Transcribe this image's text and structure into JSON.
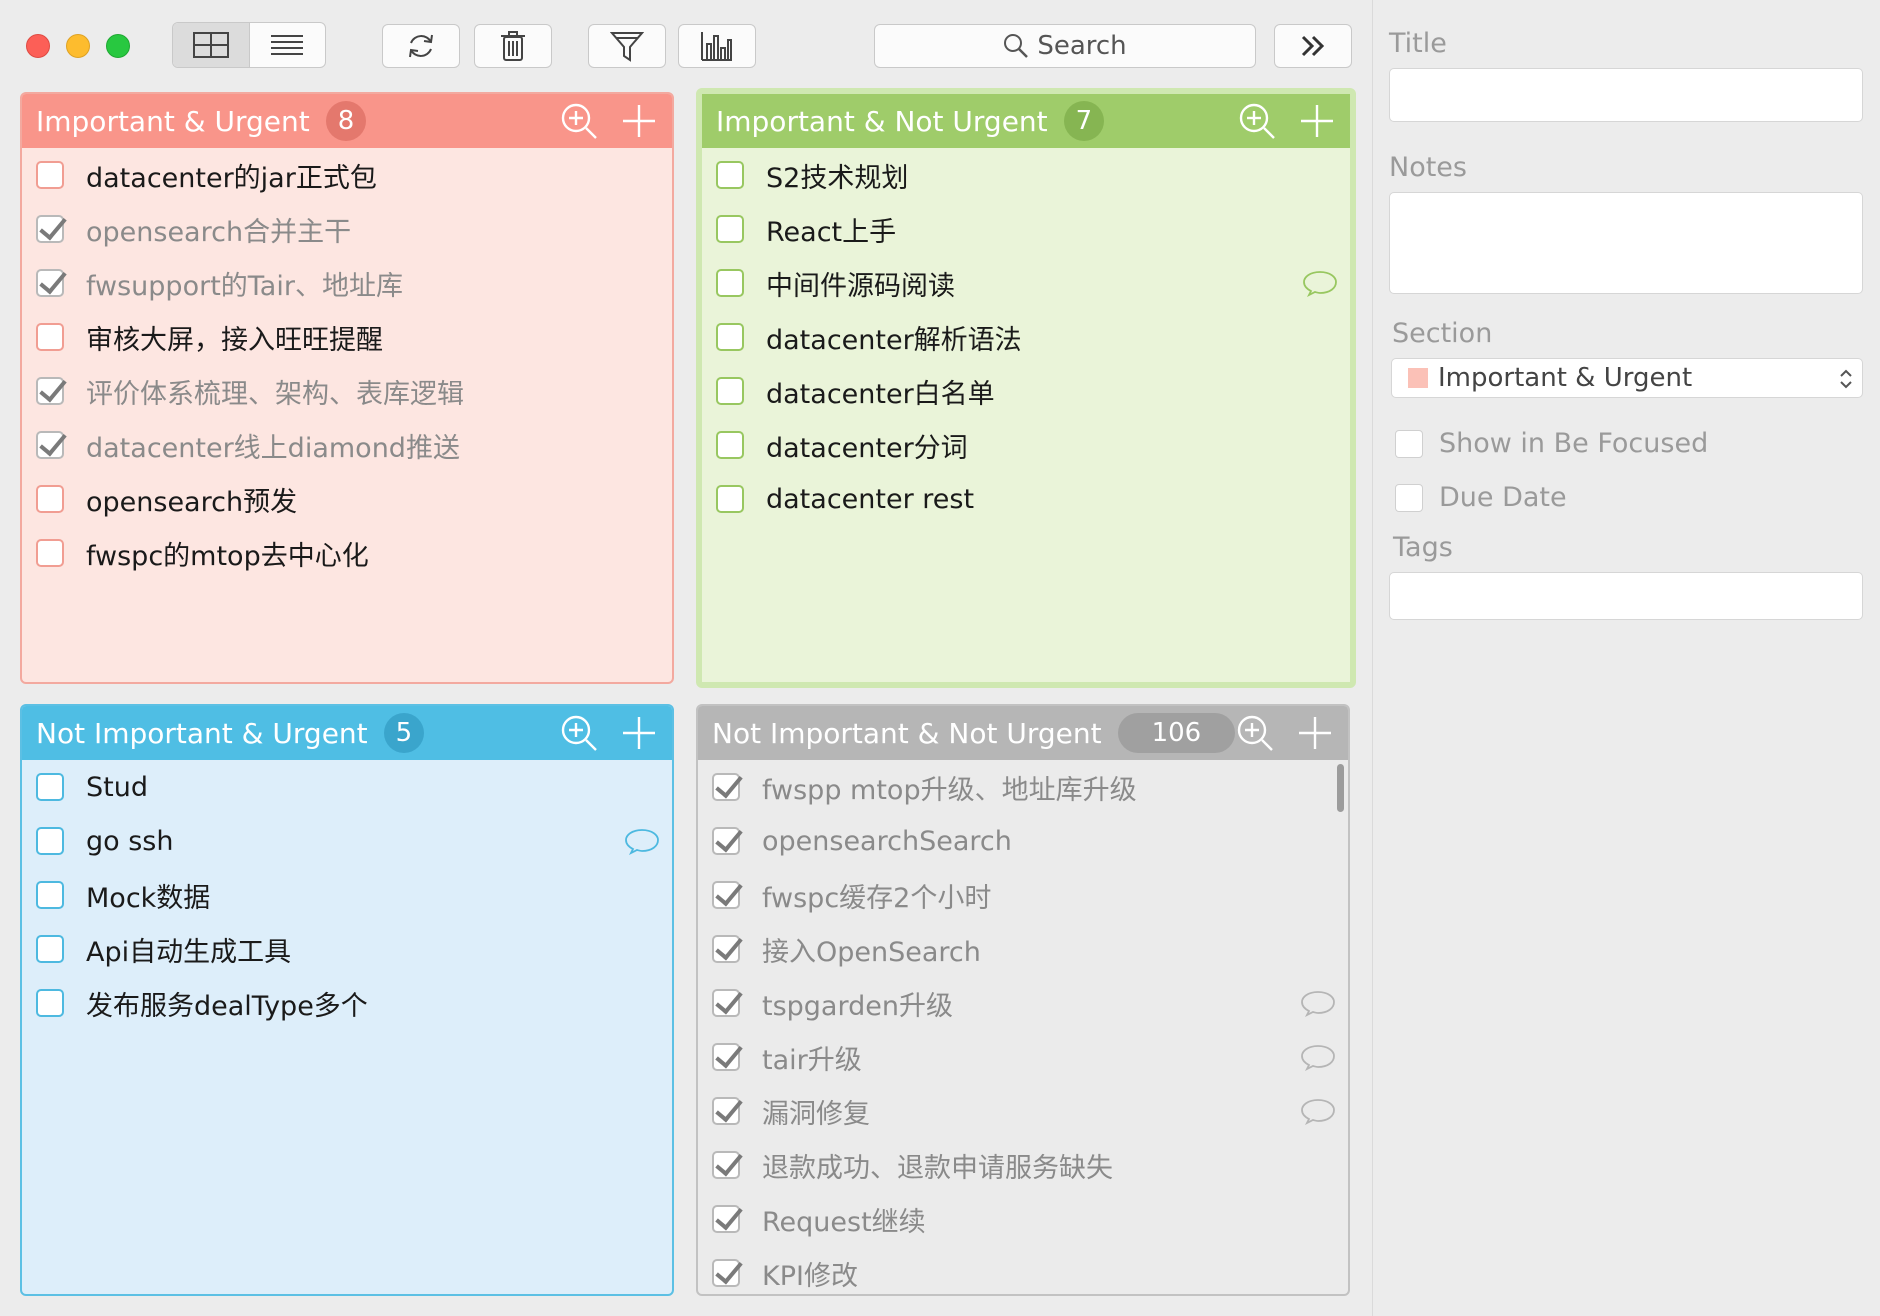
{
  "toolbar": {
    "search_placeholder": "Search"
  },
  "colors": {
    "q1_head": "#f9958a",
    "q1_body": "#fde6e1",
    "q1_border": "#f3a99f",
    "q1_cb": "#f19d92",
    "q2_head": "#9fcc6a",
    "q2_body": "#eaf4d9",
    "q2_border": "#a8d27a",
    "q2_cb": "#98c760",
    "q3_head": "#4fbee4",
    "q3_body": "#ddeefa",
    "q3_border": "#5cc0e4",
    "q3_cb": "#4db9e0",
    "q4_head": "#b6b6b6",
    "q4_body": "#ebebeb",
    "q4_border": "#c2c2c2",
    "q4_cb": "#ababab"
  },
  "quadrants": [
    {
      "title": "Important & Urgent",
      "count": "8",
      "tasks": [
        {
          "label": "datacenter的jar正式包",
          "done": false
        },
        {
          "label": "opensearch合并主干",
          "done": true
        },
        {
          "label": "fwsupport的Tair、地址库",
          "done": true
        },
        {
          "label": "审核大屏，接入旺旺提醒",
          "done": false
        },
        {
          "label": "评价体系梳理、架构、表库逻辑",
          "done": true
        },
        {
          "label": "datacenter线上diamond推送",
          "done": true
        },
        {
          "label": "opensearch预发",
          "done": false
        },
        {
          "label": "fwspc的mtop去中心化",
          "done": false
        }
      ]
    },
    {
      "title": "Important & Not Urgent",
      "count": "7",
      "tasks": [
        {
          "label": "S2技术规划",
          "done": false
        },
        {
          "label": "React上手",
          "done": false
        },
        {
          "label": "中间件源码阅读",
          "done": false,
          "note": true
        },
        {
          "label": "datacenter解析语法",
          "done": false
        },
        {
          "label": "datacenter白名单",
          "done": false
        },
        {
          "label": "datacenter分词",
          "done": false
        },
        {
          "label": "datacenter rest",
          "done": false
        }
      ]
    },
    {
      "title": "Not Important & Urgent",
      "count": "5",
      "tasks": [
        {
          "label": "Stud",
          "done": false
        },
        {
          "label": "go ssh",
          "done": false,
          "note": true
        },
        {
          "label": "Mock数据",
          "done": false
        },
        {
          "label": "Api自动生成工具",
          "done": false
        },
        {
          "label": "发布服务dealType多个",
          "done": false
        }
      ]
    },
    {
      "title": "Not Important & Not Urgent",
      "count": "106",
      "tasks": [
        {
          "label": "fwspp mtop升级、地址库升级",
          "done": true
        },
        {
          "label": "opensearchSearch",
          "done": true
        },
        {
          "label": "fwspc缓存2个小时",
          "done": true
        },
        {
          "label": "接入OpenSearch",
          "done": true
        },
        {
          "label": "tspgarden升级",
          "done": true,
          "note": true
        },
        {
          "label": "tair升级",
          "done": true,
          "note": true
        },
        {
          "label": "漏洞修复",
          "done": true,
          "note": true
        },
        {
          "label": "退款成功、退款申请服务缺失",
          "done": true
        },
        {
          "label": "Request继续",
          "done": true
        },
        {
          "label": "KPI修改",
          "done": true
        }
      ]
    }
  ],
  "sidebar": {
    "title_label": "Title",
    "notes_label": "Notes",
    "section_label": "Section",
    "section_value": "Important & Urgent",
    "show_focused_label": "Show in Be Focused",
    "due_date_label": "Due Date",
    "tags_label": "Tags"
  }
}
